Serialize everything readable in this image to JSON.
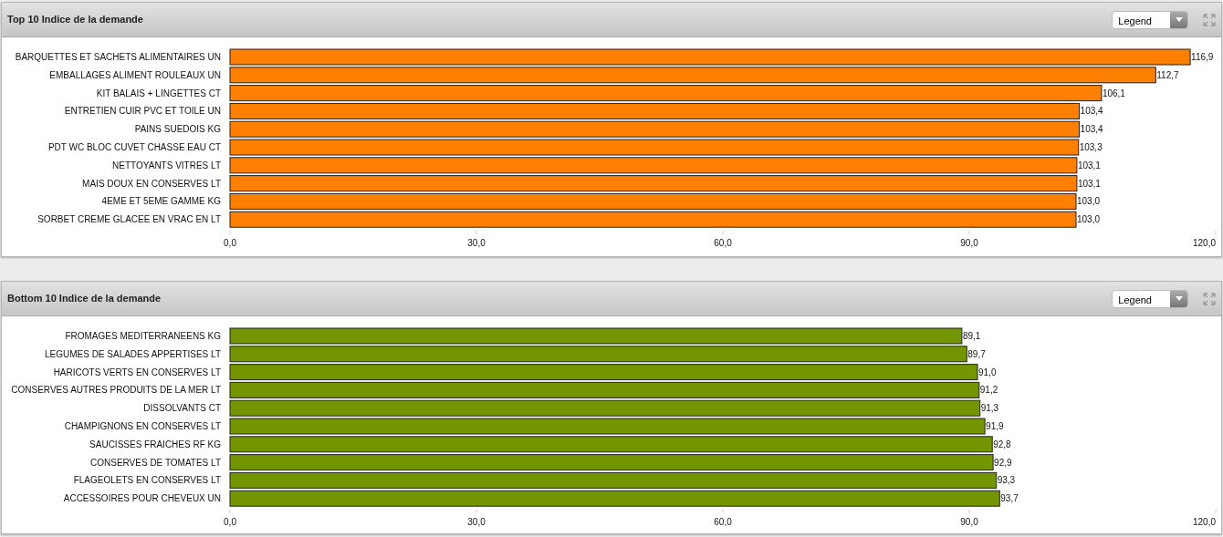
{
  "panels": [
    {
      "title": "Top 10 Indice de la demande",
      "legend_dropdown": {
        "value": "Legend"
      },
      "chart_data": {
        "type": "bar",
        "orientation": "horizontal",
        "categories": [
          "BARQUETTES ET SACHETS ALIMENTAIRES UN",
          "EMBALLAGES ALIMENT ROULEAUX UN",
          "KIT BALAIS + LINGETTES CT",
          "ENTRETIEN CUIR PVC ET TOILE UN",
          "PAINS SUEDOIS KG",
          "PDT WC BLOC CUVET CHASSE EAU CT",
          "NETTOYANTS VITRES LT",
          "MAIS DOUX EN CONSERVES LT",
          "4EME ET 5EME GAMME KG",
          "SORBET CREME GLACEE EN VRAC EN LT"
        ],
        "series": [
          {
            "color": "#ff7f00",
            "values": [
              116.9,
              112.7,
              106.1,
              103.4,
              103.4,
              103.3,
              103.1,
              103.1,
              103.0,
              103.0
            ]
          }
        ],
        "value_labels": [
          "116,9",
          "112,7",
          "106,1",
          "103,4",
          "103,4",
          "103,3",
          "103,1",
          "103,1",
          "103,0",
          "103,0"
        ],
        "xlim": [
          0,
          120
        ],
        "xticks": [
          {
            "value": 0,
            "label": "0,0"
          },
          {
            "value": 30,
            "label": "30,0"
          },
          {
            "value": 60,
            "label": "60,0"
          },
          {
            "value": 90,
            "label": "90,0"
          },
          {
            "value": 120,
            "label": "120,0"
          }
        ]
      }
    },
    {
      "title": "Bottom 10 Indice de la demande",
      "legend_dropdown": {
        "value": "Legend"
      },
      "chart_data": {
        "type": "bar",
        "orientation": "horizontal",
        "categories": [
          "FROMAGES MEDITERRANEENS KG",
          "LEGUMES DE SALADES APPERTISES LT",
          "HARICOTS VERTS EN CONSERVES LT",
          "CONSERVES AUTRES PRODUITS DE LA MER LT",
          "DISSOLVANTS CT",
          "CHAMPIGNONS EN CONSERVES LT",
          "SAUCISSES FRAICHES RF KG",
          "CONSERVES DE TOMATES LT",
          "FLAGEOLETS EN CONSERVES LT",
          "ACCESSOIRES POUR CHEVEUX UN"
        ],
        "series": [
          {
            "color": "#739600",
            "values": [
              89.1,
              89.7,
              91.0,
              91.2,
              91.3,
              91.9,
              92.8,
              92.9,
              93.3,
              93.7
            ]
          }
        ],
        "value_labels": [
          "89,1",
          "89,7",
          "91,0",
          "91,2",
          "91,3",
          "91,9",
          "92,8",
          "92,9",
          "93,3",
          "93,7"
        ],
        "xlim": [
          0,
          120
        ],
        "xticks": [
          {
            "value": 0,
            "label": "0,0"
          },
          {
            "value": 30,
            "label": "30,0"
          },
          {
            "value": 60,
            "label": "60,0"
          },
          {
            "value": 90,
            "label": "90,0"
          },
          {
            "value": 120,
            "label": "120,0"
          }
        ]
      }
    }
  ]
}
